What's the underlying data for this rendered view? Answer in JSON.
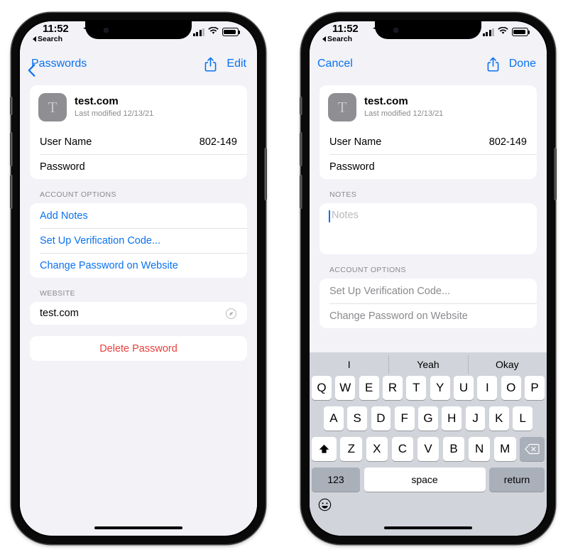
{
  "left_phone": {
    "status_bar": {
      "time": "11:52",
      "back_label": "Search",
      "location_icon": "location-arrow-icon",
      "cellular_icon": "signal-bars-icon",
      "wifi_icon": "wifi-icon",
      "battery_icon": "battery-icon"
    },
    "nav": {
      "back_label": "Passwords",
      "share_icon": "share-icon",
      "right_label": "Edit"
    },
    "account_header": {
      "icon_letter": "T",
      "title": "test.com",
      "subtitle": "Last modified 12/13/21"
    },
    "credentials": [
      {
        "label": "User Name",
        "value": "802-149"
      },
      {
        "label": "Password",
        "value": ""
      }
    ],
    "account_options_label": "ACCOUNT OPTIONS",
    "account_options": [
      {
        "label": "Add Notes"
      },
      {
        "label": "Set Up Verification Code..."
      },
      {
        "label": "Change Password on Website"
      }
    ],
    "website_label": "WEBSITE",
    "website_value": "test.com",
    "website_icon": "safari-compass-icon",
    "delete_label": "Delete Password",
    "delete_color": "#e8413d",
    "link_color": "#0a72ef"
  },
  "right_phone": {
    "status_bar": {
      "time": "11:52",
      "back_label": "Search",
      "location_icon": "location-arrow-icon",
      "cellular_icon": "signal-bars-icon",
      "wifi_icon": "wifi-icon",
      "battery_icon": "battery-icon"
    },
    "nav": {
      "back_label": "Cancel",
      "share_icon": "share-icon",
      "right_label": "Done"
    },
    "account_header": {
      "icon_letter": "T",
      "title": "test.com",
      "subtitle": "Last modified 12/13/21"
    },
    "credentials": [
      {
        "label": "User Name",
        "value": "802-149"
      },
      {
        "label": "Password",
        "value": ""
      }
    ],
    "notes_label": "NOTES",
    "notes_placeholder": "Notes",
    "account_options_label": "ACCOUNT OPTIONS",
    "account_options": [
      {
        "label": "Set Up Verification Code..."
      },
      {
        "label": "Change Password on Website"
      }
    ],
    "keyboard": {
      "predictions": [
        "I",
        "Yeah",
        "Okay"
      ],
      "row1": [
        "Q",
        "W",
        "E",
        "R",
        "T",
        "Y",
        "U",
        "I",
        "O",
        "P"
      ],
      "row2": [
        "A",
        "S",
        "D",
        "F",
        "G",
        "H",
        "J",
        "K",
        "L"
      ],
      "row3_letters": [
        "Z",
        "X",
        "C",
        "V",
        "B",
        "N",
        "M"
      ],
      "shift_icon": "shift-up-arrow-icon",
      "delete_icon": "backspace-delete-icon",
      "numbers_label": "123",
      "space_label": "space",
      "return_label": "return",
      "emoji_icon": "smiley-face-icon"
    }
  }
}
